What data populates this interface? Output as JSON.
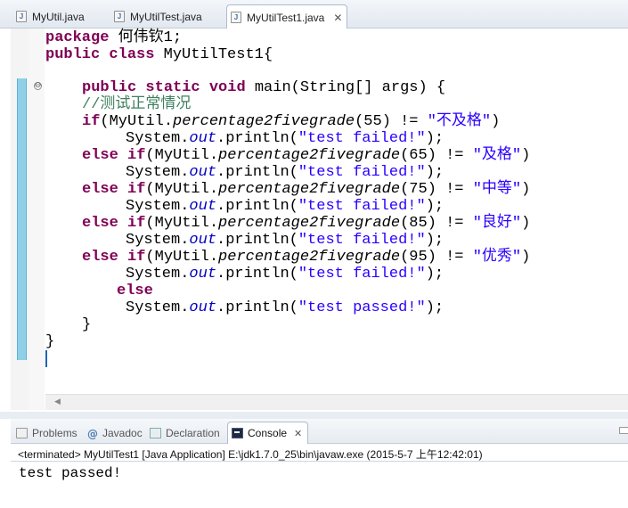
{
  "editor_tabs": [
    {
      "label": "MyUtil.java",
      "icon": "java-file-icon"
    },
    {
      "label": "MyUtilTest.java",
      "icon": "java-file-icon"
    },
    {
      "label": "MyUtilTest1.java",
      "icon": "java-file-icon",
      "active": true,
      "close": "✕"
    }
  ],
  "code": {
    "l1": {
      "kw": "package",
      "rest": " 何伟钦1;"
    },
    "l2": {
      "kw1": "public",
      "kw2": "class",
      "rest": " MyUtilTest1{"
    },
    "l4": {
      "kw1": "public",
      "kw2": "static",
      "kw3": "void",
      "rest": " main(String[] args) {"
    },
    "l5": {
      "comment": "//测试正常情况"
    },
    "conditions": [
      {
        "kw": "if",
        "arg": "55",
        "str": "\"不及格\"",
        "close": ")"
      },
      {
        "kw": "else if",
        "arg": "65",
        "str": "\"及格\"",
        "close": ")"
      },
      {
        "kw": "else if",
        "arg": "75",
        "str": "\"中等\"",
        "close": ")"
      },
      {
        "kw": "else if",
        "arg": "85",
        "str": "\"良好\"",
        "close": ")"
      },
      {
        "kw": "else if",
        "arg": "95",
        "str": "\"优秀\"",
        "close": ")"
      }
    ],
    "cond_prefix": "(MyUtil.",
    "cond_method": "percentage2fivegrade",
    "cond_mid_a": "(",
    "cond_mid_b": ") != ",
    "print_prefix": "System.",
    "print_out": "out",
    "print_mid": ".println(",
    "print_failed": "\"test failed!\"",
    "print_passed": "\"test passed!\"",
    "print_suffix": ");",
    "else_kw": "else",
    "close_method": "}",
    "close_class": "}"
  },
  "view_tabs": [
    {
      "label": "Problems",
      "icon": "problems-icon"
    },
    {
      "label": "Javadoc",
      "icon": "javadoc-at-icon",
      "glyph": "@"
    },
    {
      "label": "Declaration",
      "icon": "declaration-icon"
    },
    {
      "label": "Console",
      "icon": "console-icon",
      "active": true,
      "close": "✕"
    }
  ],
  "console": {
    "header": "<terminated> MyUtilTest1 [Java Application] E:\\jdk1.7.0_25\\bin\\javaw.exe (2015-5-7 上午12:42:01)",
    "output": "test passed!"
  },
  "fold_glyph": "⊖",
  "scroll_left_glyph": "◀"
}
